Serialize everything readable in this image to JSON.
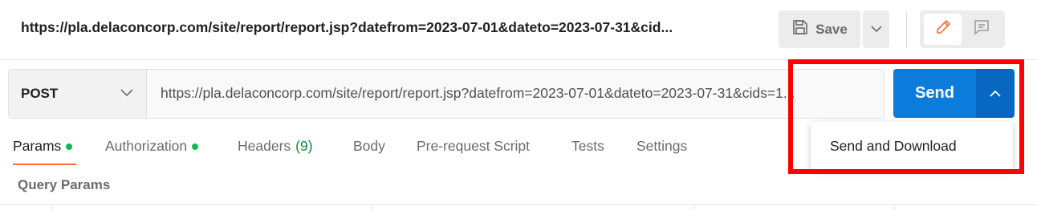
{
  "header": {
    "title": "https://pla.delaconcorp.com/site/report/report.jsp?datefrom=2023-07-01&dateto=2023-07-31&cid...",
    "save_label": "Save"
  },
  "request": {
    "method": "POST",
    "url": "https://pla.delaconcorp.com/site/report/report.jsp?datefrom=2023-07-01&dateto=2023-07-31&cids=1...",
    "send_label": "Send"
  },
  "tabs": [
    {
      "label": "Params",
      "dot": true
    },
    {
      "label": "Authorization",
      "dot": true
    },
    {
      "label": "Headers",
      "count": "(9)"
    },
    {
      "label": "Body"
    },
    {
      "label": "Pre-request Script"
    },
    {
      "label": "Tests"
    },
    {
      "label": "Settings"
    }
  ],
  "section": {
    "title": "Query Params"
  },
  "dropdown": {
    "item": "Send and Download"
  },
  "colors": {
    "send_blue": "#0b7bdc",
    "send_caret_blue": "#0867c0",
    "active_tab_underline": "#ff6c37",
    "status_dot": "#0cbb52",
    "highlight_red": "#ff0000"
  },
  "icons": [
    "save-icon",
    "chevron-down-icon",
    "pencil-icon",
    "comment-icon",
    "chevron-up-icon"
  ]
}
